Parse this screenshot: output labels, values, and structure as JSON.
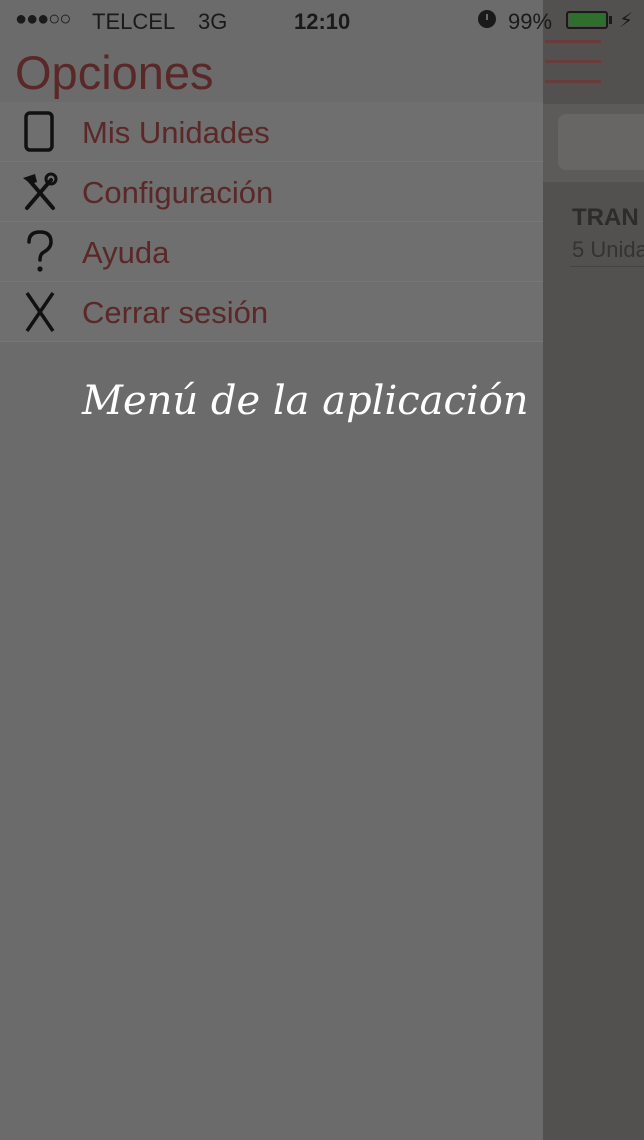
{
  "status_bar": {
    "signal": "●●●○○",
    "carrier": "TELCEL",
    "network": "3G",
    "time": "12:10",
    "alarm_icon": "alarm-clock-icon",
    "battery_percent": "99%",
    "battery_level": 0.99,
    "charging_icon": "lightning-icon"
  },
  "menu": {
    "title": "Opciones",
    "items": [
      {
        "label": "Mis Unidades",
        "icon": "tablet-icon"
      },
      {
        "label": "Configuración",
        "icon": "tools-icon"
      },
      {
        "label": "Ayuda",
        "icon": "question-icon"
      },
      {
        "label": "Cerrar sesión",
        "icon": "close-x-icon"
      }
    ]
  },
  "caption": "Menú de la aplicación",
  "background_app": {
    "row_title": "TRAN",
    "row_subtitle": "5 Unida"
  },
  "colors": {
    "menu_text": "#5a2828",
    "overlay": "#6b6b6b",
    "battery_fill": "#2e6f2e"
  }
}
